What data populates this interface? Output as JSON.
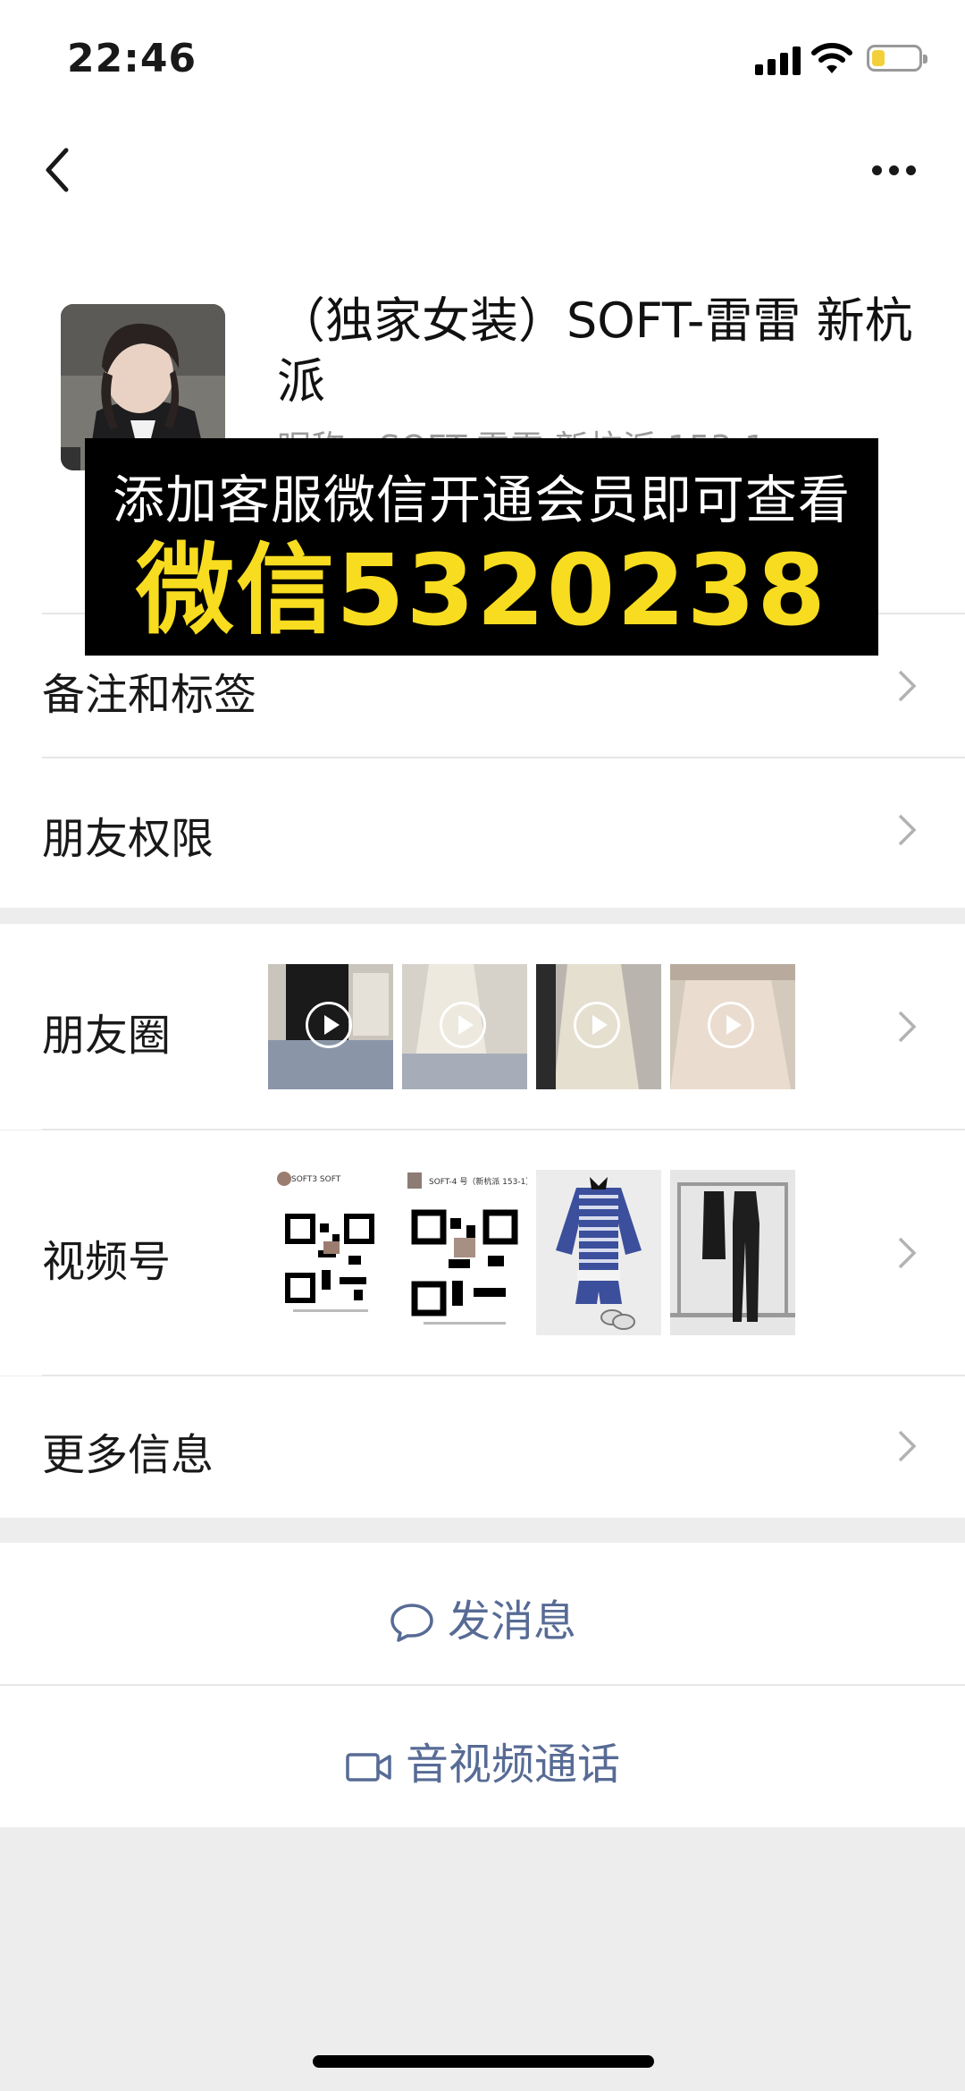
{
  "status_bar": {
    "time": "22:46"
  },
  "profile": {
    "name": "（独家女装）SOFT-雷雷 新杭派",
    "sub_text": "昵称：SOFT-雷雷 新杭派 153-1"
  },
  "promo": {
    "line1": "添加客服微信开通会员即可查看",
    "line2": "微信5320238"
  },
  "rows": {
    "remark": "备注和标签",
    "permission": "朋友权限",
    "moments": "朋友圈",
    "channels": "视频号",
    "more_info": "更多信息"
  },
  "channels_thumbs": {
    "qr1_title": "SOFT3 SOFT",
    "qr2_title": "SOFT-4 号（新杭派 153-1）"
  },
  "actions": {
    "message": "发消息",
    "call": "音视频通话"
  },
  "colors": {
    "accent_link": "#576b95",
    "promo_yellow": "#f7dc1f",
    "background": "#ededed"
  }
}
